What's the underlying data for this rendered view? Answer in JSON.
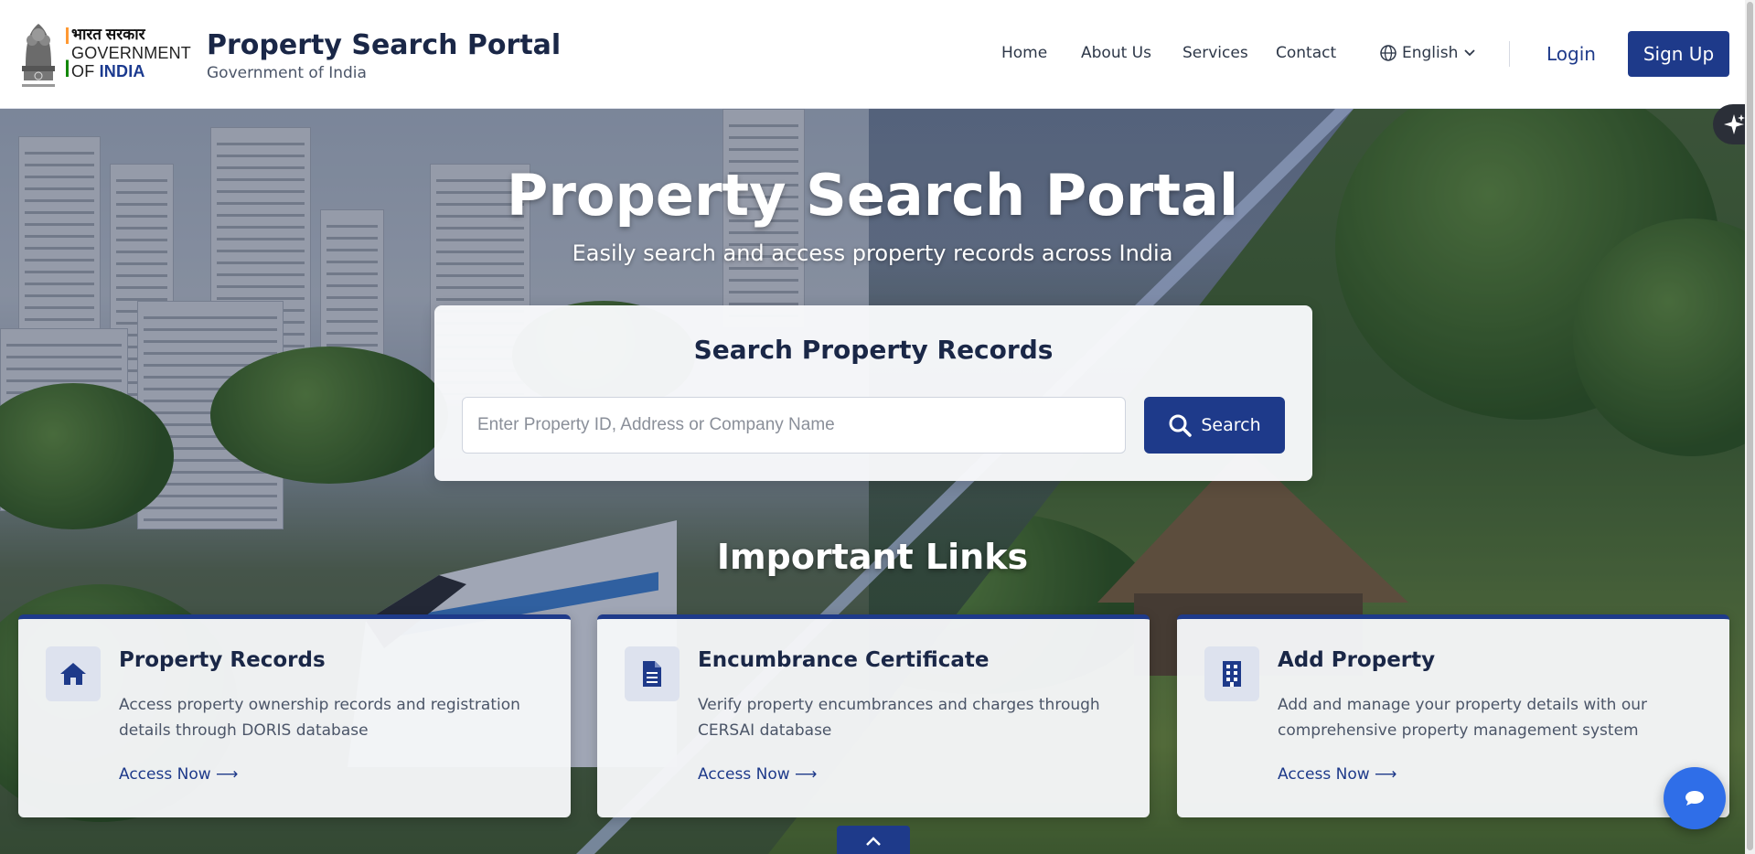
{
  "header": {
    "gov_hindi": "भारत सरकार",
    "gov_line1": "GOVERNMENT",
    "gov_line2_of": "OF",
    "gov_line2_india": "INDIA",
    "brand_title": "Property Search Portal",
    "brand_subtitle": "Government of India",
    "nav": [
      {
        "label": "Home"
      },
      {
        "label": "About Us"
      },
      {
        "label": "Services"
      },
      {
        "label": "Contact"
      }
    ],
    "language": "English",
    "login_label": "Login",
    "signup_label": "Sign Up"
  },
  "hero": {
    "title": "Property Search Portal",
    "subtitle": "Easily search and access property records across India"
  },
  "search": {
    "title": "Search Property Records",
    "placeholder": "Enter Property ID, Address or Company Name",
    "value": "",
    "button_label": "Search"
  },
  "links": {
    "title": "Important Links",
    "cards": [
      {
        "icon": "home-icon",
        "title": "Property Records",
        "description": "Access property ownership records and registration details through DORIS database",
        "link": "Access Now ⟶"
      },
      {
        "icon": "document-icon",
        "title": "Encumbrance Certificate",
        "description": "Verify property encumbrances and charges through CERSAI database",
        "link": "Access Now ⟶"
      },
      {
        "icon": "building-icon",
        "title": "Add Property",
        "description": "Add and manage your property details with our comprehensive property management system",
        "link": "Access Now ⟶"
      }
    ]
  },
  "colors": {
    "primary": "#1e3a8a",
    "chat": "#2f6ee8",
    "saffron": "#ff7a00"
  }
}
